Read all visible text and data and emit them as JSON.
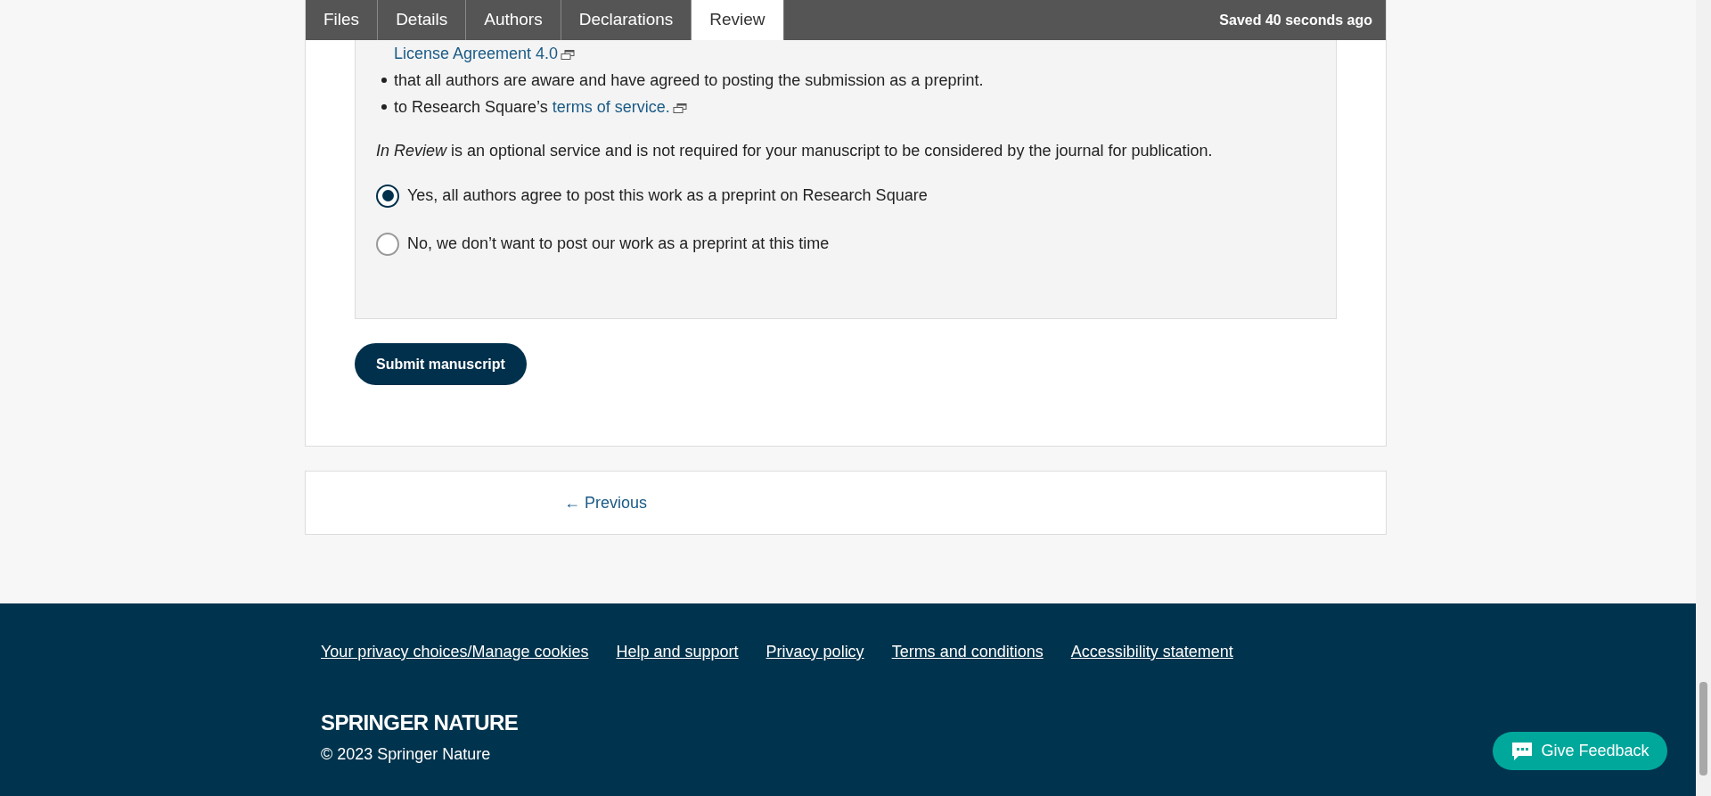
{
  "tabs": [
    {
      "label": "Files",
      "selected": false
    },
    {
      "label": "Details",
      "selected": false
    },
    {
      "label": "Authors",
      "selected": false
    },
    {
      "label": "Declarations",
      "selected": false
    },
    {
      "label": "Review",
      "selected": true
    }
  ],
  "save_status": "Saved 40 seconds ago",
  "agreement_items": [
    {
      "kind": "continuation",
      "link": "License Agreement 4.0"
    },
    {
      "kind": "bullet",
      "text": "that all authors are aware and have agreed to posting the submission as a preprint."
    },
    {
      "kind": "bullet",
      "text": "to Research Square’s ",
      "link": "terms of service."
    }
  ],
  "note": "*In Review* is an optional service and is not required for your manuscript to be considered by the journal for publication.",
  "options": [
    {
      "label": "Yes, all authors agree to post this work as a preprint on Research Square",
      "selected": true
    },
    {
      "label": "No, we don’t want to post our work as a preprint at this time",
      "selected": false
    }
  ],
  "submit_button": "Submit manuscript",
  "previous_link": "← Previous",
  "footer": {
    "links": [
      "Your privacy choices/Manage cookies",
      "Help and support",
      "Privacy policy",
      "Terms and conditions",
      "Accessibility statement"
    ],
    "logo": "SPRINGER NATURE",
    "copyright": "© 2023 Springer Nature"
  },
  "feedback_button": "Give Feedback"
}
